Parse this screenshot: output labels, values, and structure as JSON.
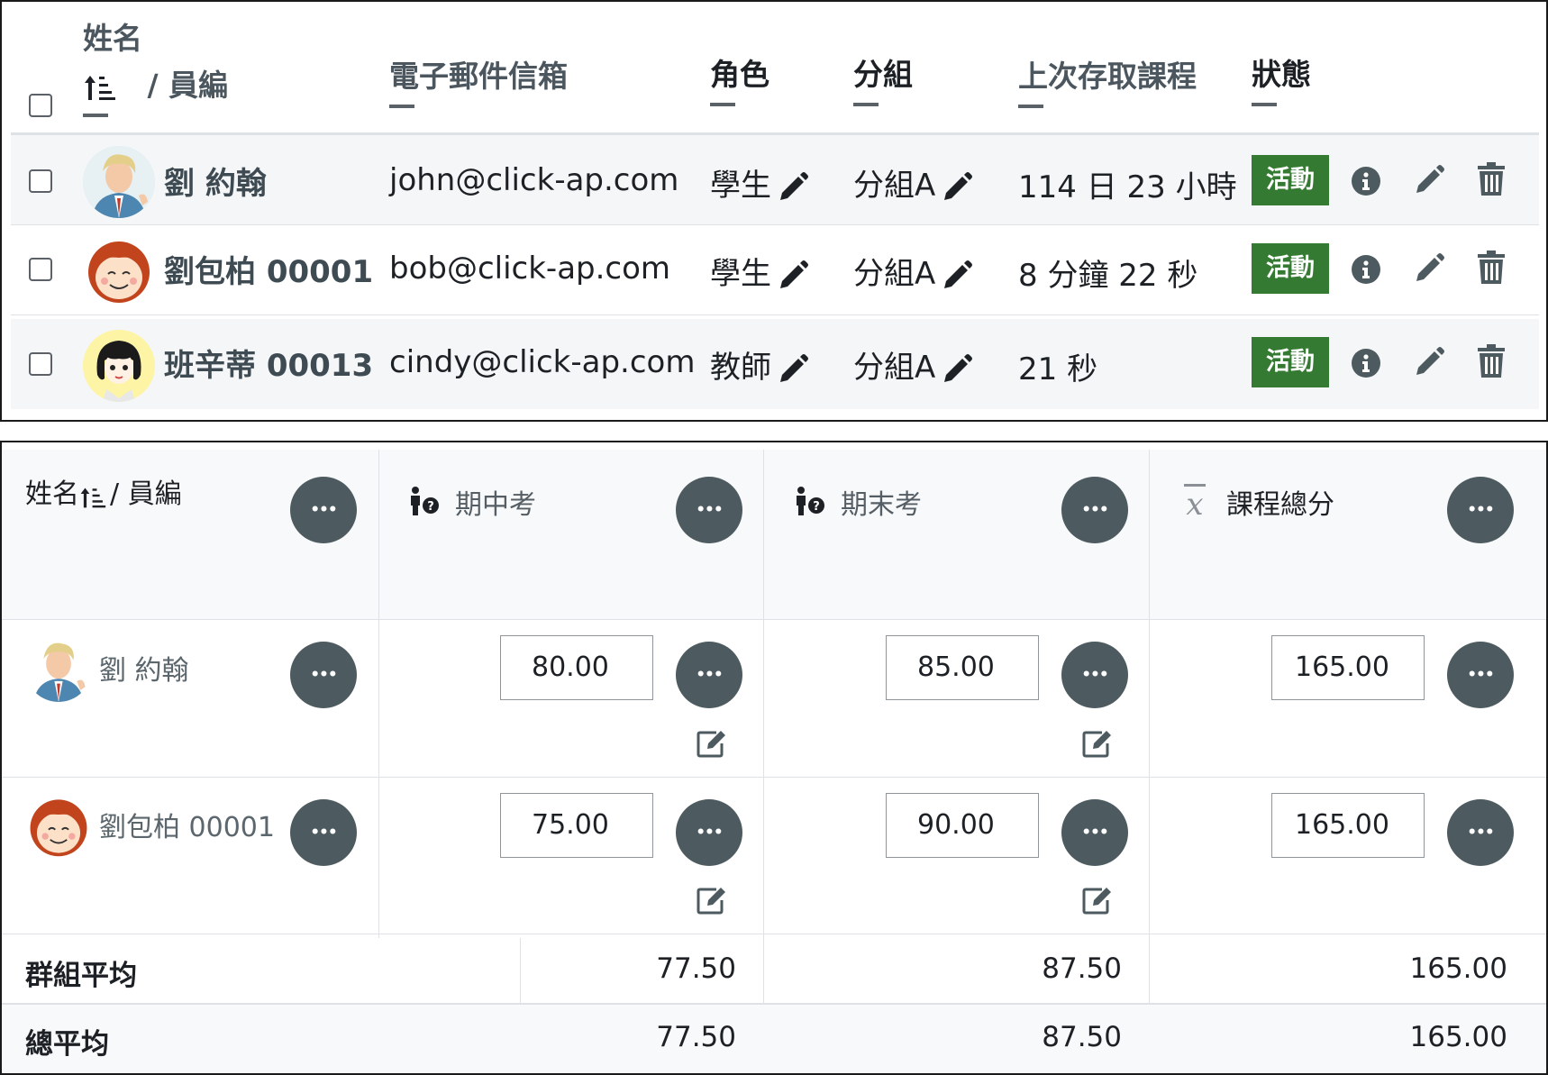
{
  "participants": {
    "headers": {
      "name_first": "姓名",
      "name_second": "/ 員編",
      "email": "電子郵件信箱",
      "role": "角色",
      "group": "分組",
      "last_access": "上次存取課程",
      "status": "狀態"
    },
    "rows": [
      {
        "name": "劉 約翰",
        "email": "john@click-ap.com",
        "role": "學生",
        "group": "分組A",
        "last_access": "114 日 23 小時",
        "status": "活動",
        "avatar": "blonde-man-avatar"
      },
      {
        "name": "劉包柏 00001",
        "email": "bob@click-ap.com",
        "role": "學生",
        "group": "分組A",
        "last_access": "8 分鐘 22 秒",
        "status": "活動",
        "avatar": "red-hair-boy-avatar"
      },
      {
        "name": "班辛蒂 00013",
        "email": "cindy@click-ap.com",
        "role": "教師",
        "group": "分組A",
        "last_access": "21 秒",
        "status": "活動",
        "avatar": "dark-hair-girl-avatar"
      }
    ],
    "colors": {
      "badge": "#357a32",
      "link": "#4b565e",
      "row_alt": "#f5f6f7"
    }
  },
  "grades": {
    "headers": {
      "name": "姓名",
      "name_second": "/ 員編",
      "midterm": "期中考",
      "final": "期末考",
      "total": "課程總分"
    },
    "rows": [
      {
        "name": "劉 約翰",
        "midterm": "80.00",
        "final": "85.00",
        "total": "165.00"
      },
      {
        "name": "劉包柏 00001",
        "midterm": "75.00",
        "final": "90.00",
        "total": "165.00"
      }
    ],
    "summary": [
      {
        "label": "群組平均",
        "midterm": "77.50",
        "final": "87.50",
        "total": "165.00"
      },
      {
        "label": "總平均",
        "midterm": "77.50",
        "final": "87.50",
        "total": "165.00"
      }
    ],
    "colors": {
      "menu_button": "#4d5b60",
      "header_bg": "#f8f9fa"
    }
  }
}
